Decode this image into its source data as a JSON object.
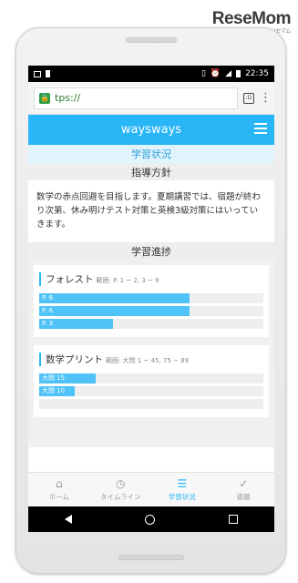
{
  "watermark": {
    "brand": "ReseMom",
    "sub": "リセマム"
  },
  "statusbar": {
    "time": "22:35"
  },
  "browser": {
    "url": "tps://",
    "tab_count": ":D"
  },
  "appbar": {
    "title": "waysways"
  },
  "tabs": {
    "current": "学習状況"
  },
  "policy": {
    "heading": "指導方針",
    "text": "数学の赤点回避を目指します。夏期講習では、宿題が終わり次第、休み明けテスト対策と英検3級対策にはいっていきます。"
  },
  "progress": {
    "heading": "学習進捗",
    "cards": [
      {
        "title": "フォレスト",
        "range": "範囲: P. 1 ~ 2, 3 ~ 9",
        "bars": [
          {
            "label": "P. 6",
            "value": 0.67
          },
          {
            "label": "P. 6",
            "value": 0.67
          },
          {
            "label": "P. 3",
            "value": 0.33
          }
        ]
      },
      {
        "title": "数学プリント",
        "range": "範囲: 大問 1 ~ 45, 75 ~ 89",
        "bars": [
          {
            "label": "大問 15",
            "value": 0.25
          },
          {
            "label": "大問 10",
            "value": 0.16
          },
          {
            "label": "",
            "value": 0
          }
        ]
      }
    ]
  },
  "bottomnav": [
    {
      "label": "ホーム",
      "icon": "home-icon",
      "active": false
    },
    {
      "label": "タイムライン",
      "icon": "clock-icon",
      "active": false
    },
    {
      "label": "学習状況",
      "icon": "list-icon",
      "active": true
    },
    {
      "label": "宿題",
      "icon": "checklist-icon",
      "active": false
    }
  ],
  "colors": {
    "accent": "#29b6f6",
    "bar_fill": "#4fc3f7",
    "tab_bg": "#e1f4fd"
  }
}
